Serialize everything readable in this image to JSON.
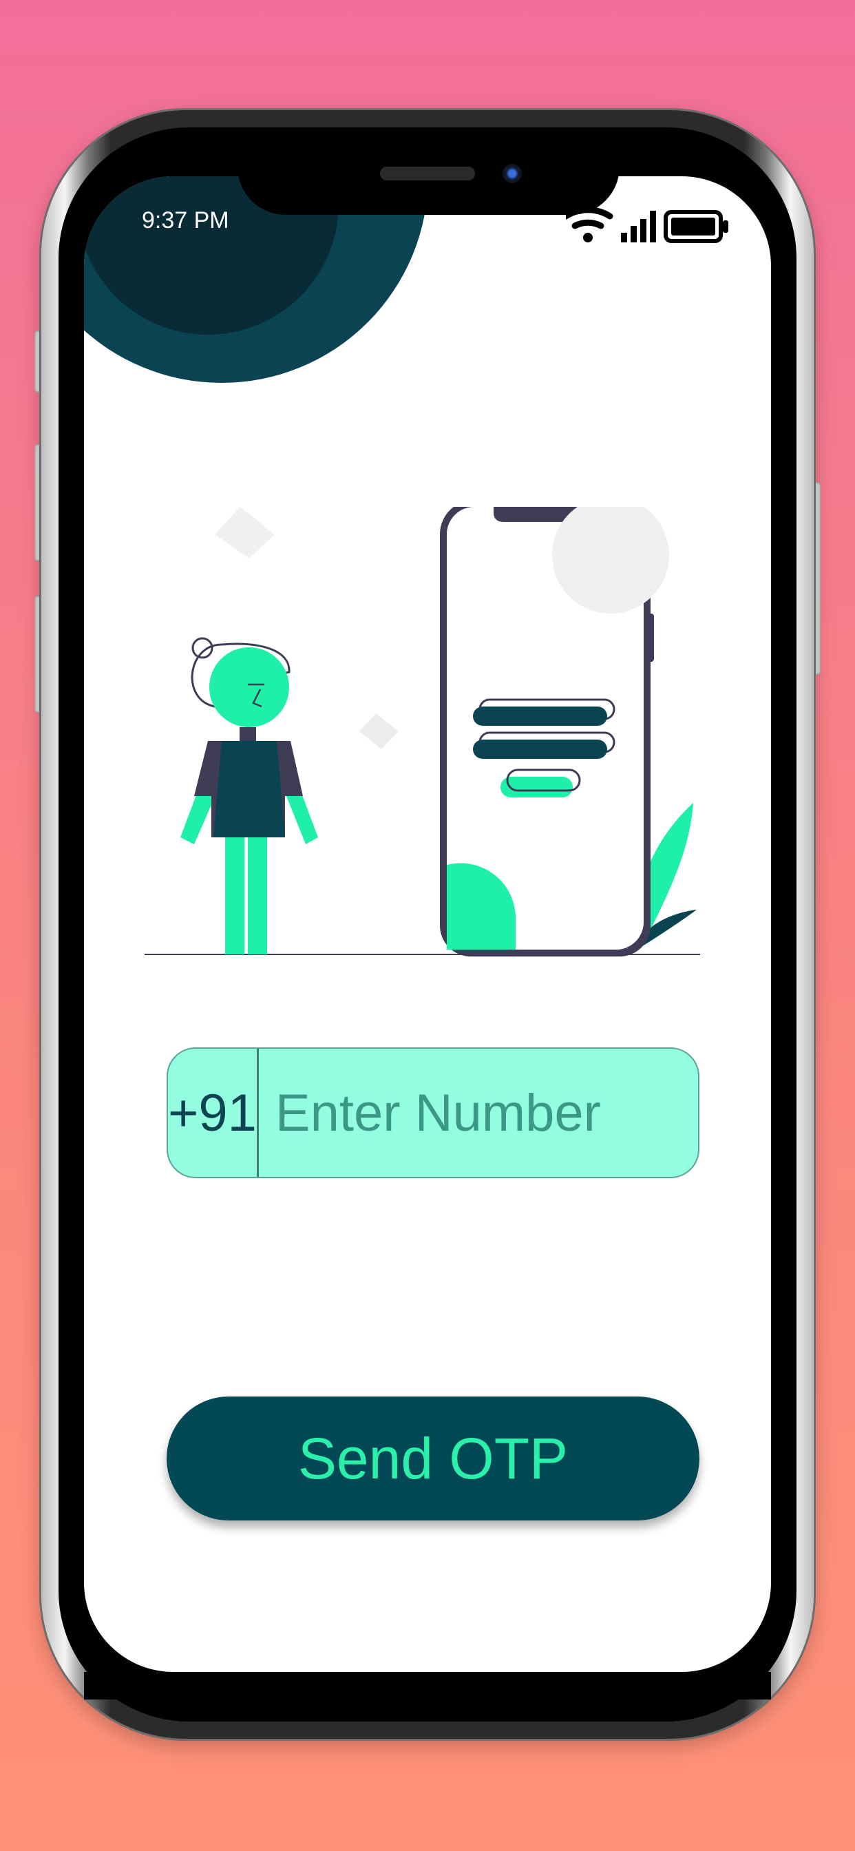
{
  "status_bar": {
    "time": "9:37 PM",
    "icons": [
      "wifi-icon",
      "cellular-signal-icon",
      "battery-icon"
    ]
  },
  "login": {
    "country_code": "+91",
    "number_placeholder": "Enter Number",
    "number_value": "",
    "send_otp_label": "Send OTP"
  },
  "colors": {
    "accent_green": "#2af1a9",
    "dark_teal": "#034855",
    "input_fill": "#93ffe0",
    "illustration_dark": "#3f3d56"
  }
}
